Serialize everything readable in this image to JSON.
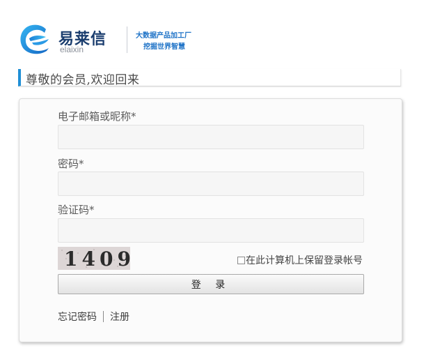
{
  "logo": {
    "name_cn": "易莱信",
    "name_en": "elaixin",
    "slogan_line1": "大数据产品加工厂",
    "slogan_line2": "挖掘世界智慧",
    "icon": "elaixin-logo-icon"
  },
  "welcome": {
    "heading": "尊敬的会员,欢迎回来"
  },
  "form": {
    "email_label": "电子邮箱或昵称*",
    "email_value": "",
    "password_label": "密码*",
    "password_value": "",
    "captcha_label": "验证码*",
    "captcha_value": "",
    "captcha_image_text": "1409",
    "remember_label": "在此计算机上保留登录帐号",
    "remember_checked": false,
    "login_button": "登 录"
  },
  "links": {
    "forgot_password": "忘记密码",
    "register": "注册"
  },
  "colors": {
    "accent": "#1f8fd6",
    "logo_text": "#1a3d6e",
    "slogan": "#1f73c7"
  }
}
